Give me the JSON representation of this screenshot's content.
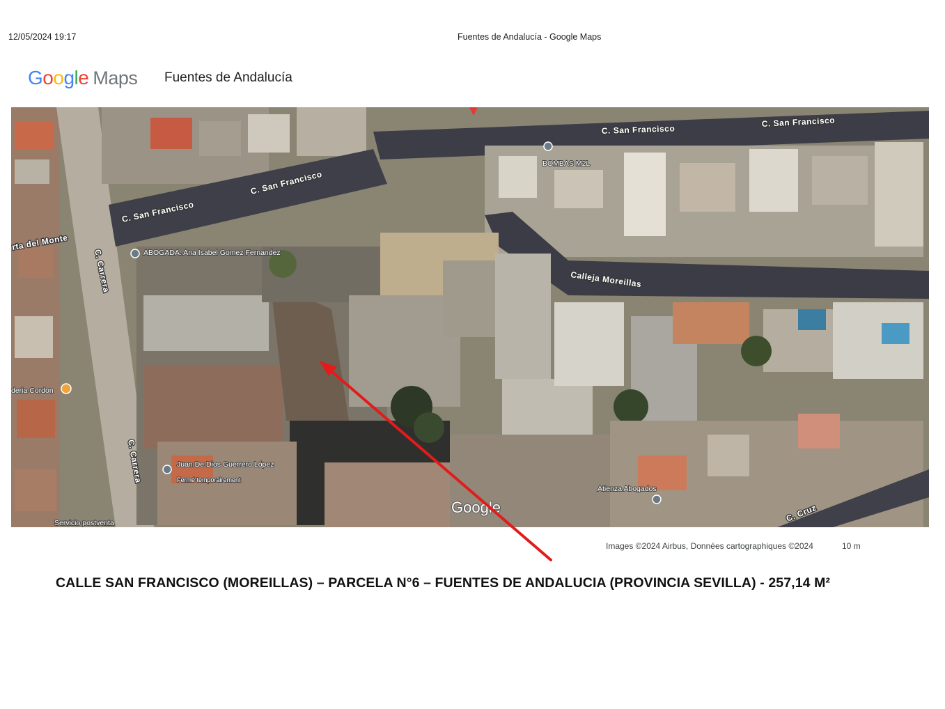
{
  "print_header": {
    "datetime": "12/05/2024 19:17",
    "title": "Fuentes de Andalucía - Google Maps"
  },
  "logo": {
    "google": "Google",
    "maps": "Maps",
    "colors": {
      "blue": "#4285F4",
      "red": "#EA4335",
      "yellow": "#FBBC05",
      "green": "#34A853",
      "gray": "#70757a"
    }
  },
  "place_name": "Fuentes de Andalucía",
  "map": {
    "view": "satellite",
    "roads": [
      "C. San Francisco",
      "C. San Francisco",
      "C. San Francisco",
      "C. San Francisco",
      "rta del Monte",
      "C. Carrera",
      "C. Carrera",
      "Calleja Moreillas",
      "C. Cruz"
    ],
    "pois": [
      {
        "name": "BOMBAS M2L",
        "icon": "map-pin-icon"
      },
      {
        "name": "ABOGADA. Ana Isabel Gomez Fernandez",
        "icon": "map-pin-icon"
      },
      {
        "name": "deria Cordon",
        "icon": "food-pin-icon"
      },
      {
        "name": "Juan De Dios Guerrero López",
        "sub": "Fermé temporairement",
        "icon": "map-pin-icon"
      },
      {
        "name": "Atienza Abogados",
        "icon": "map-pin-icon"
      },
      {
        "name": "Servicio postventa",
        "icon": "map-pin-icon"
      }
    ],
    "watermark": "Google"
  },
  "attribution": "Images ©2024 Airbus, Données cartographiques ©2024",
  "scale": "10 m",
  "annotation": {
    "arrow_color": "#e31b1b"
  },
  "caption": "CALLE SAN FRANCISCO (MOREILLAS) – PARCELA N°6 – FUENTES DE ANDALUCIA (PROVINCIA SEVILLA) - 257,14  M²"
}
